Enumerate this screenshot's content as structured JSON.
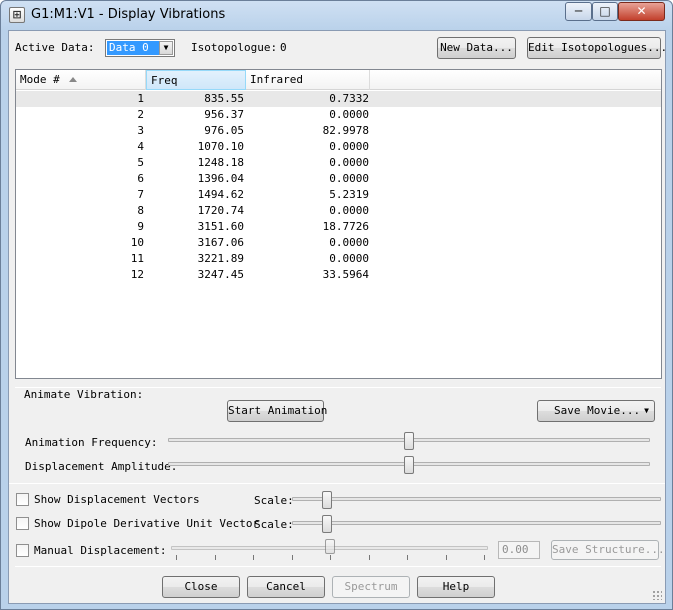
{
  "window": {
    "title": "G1:M1:V1 - Display Vibrations",
    "min_glyph": "─",
    "max_glyph": "□",
    "close_glyph": "✕",
    "app_icon_glyph": "⊞"
  },
  "top": {
    "active_data_label": "Active Data:",
    "active_data_value": "Data 0",
    "isotopologue_label": "Isotopologue:",
    "isotopologue_value": "0",
    "new_data_button": "New Data...",
    "edit_isotopologues_button": "Edit Isotopologues..."
  },
  "table": {
    "columns": [
      "Mode #",
      "Freq",
      "Infrared"
    ],
    "sorted_column": "Mode #",
    "rows": [
      {
        "mode": "1",
        "freq": "835.55",
        "ir": "0.7332"
      },
      {
        "mode": "2",
        "freq": "956.37",
        "ir": "0.0000"
      },
      {
        "mode": "3",
        "freq": "976.05",
        "ir": "82.9978"
      },
      {
        "mode": "4",
        "freq": "1070.10",
        "ir": "0.0000"
      },
      {
        "mode": "5",
        "freq": "1248.18",
        "ir": "0.0000"
      },
      {
        "mode": "6",
        "freq": "1396.04",
        "ir": "0.0000"
      },
      {
        "mode": "7",
        "freq": "1494.62",
        "ir": "5.2319"
      },
      {
        "mode": "8",
        "freq": "1720.74",
        "ir": "0.0000"
      },
      {
        "mode": "9",
        "freq": "3151.60",
        "ir": "18.7726"
      },
      {
        "mode": "10",
        "freq": "3167.06",
        "ir": "0.0000"
      },
      {
        "mode": "11",
        "freq": "3221.89",
        "ir": "0.0000"
      },
      {
        "mode": "12",
        "freq": "3247.45",
        "ir": "33.5964"
      }
    ]
  },
  "animate": {
    "section_label": "Animate Vibration:",
    "start_button": "Start Animation",
    "save_movie_button": "Save Movie...",
    "frequency_label": "Animation Frequency:",
    "frequency_level": 0.5,
    "amplitude_label": "Displacement Amplitude:",
    "amplitude_level": 0.5
  },
  "options": {
    "show_vectors_label": "Show Displacement Vectors",
    "show_vectors_checked": false,
    "show_dipole_label": "Show Dipole Derivative Unit Vector",
    "show_dipole_checked": false,
    "scale_label": "Scale:",
    "vectors_scale_level": 0.0,
    "dipole_scale_level": 0.0,
    "manual_label": "Manual Displacement:",
    "manual_checked": false,
    "manual_level": 0.5,
    "manual_value": "0.00",
    "save_structure_button": "Save Structure..."
  },
  "footer": {
    "close_button": "Close",
    "cancel_button": "Cancel",
    "spectrum_button": "Spectrum",
    "help_button": "Help"
  },
  "colors": {
    "selection": "#3399ff",
    "sorted_header": "#cfe7fa"
  }
}
